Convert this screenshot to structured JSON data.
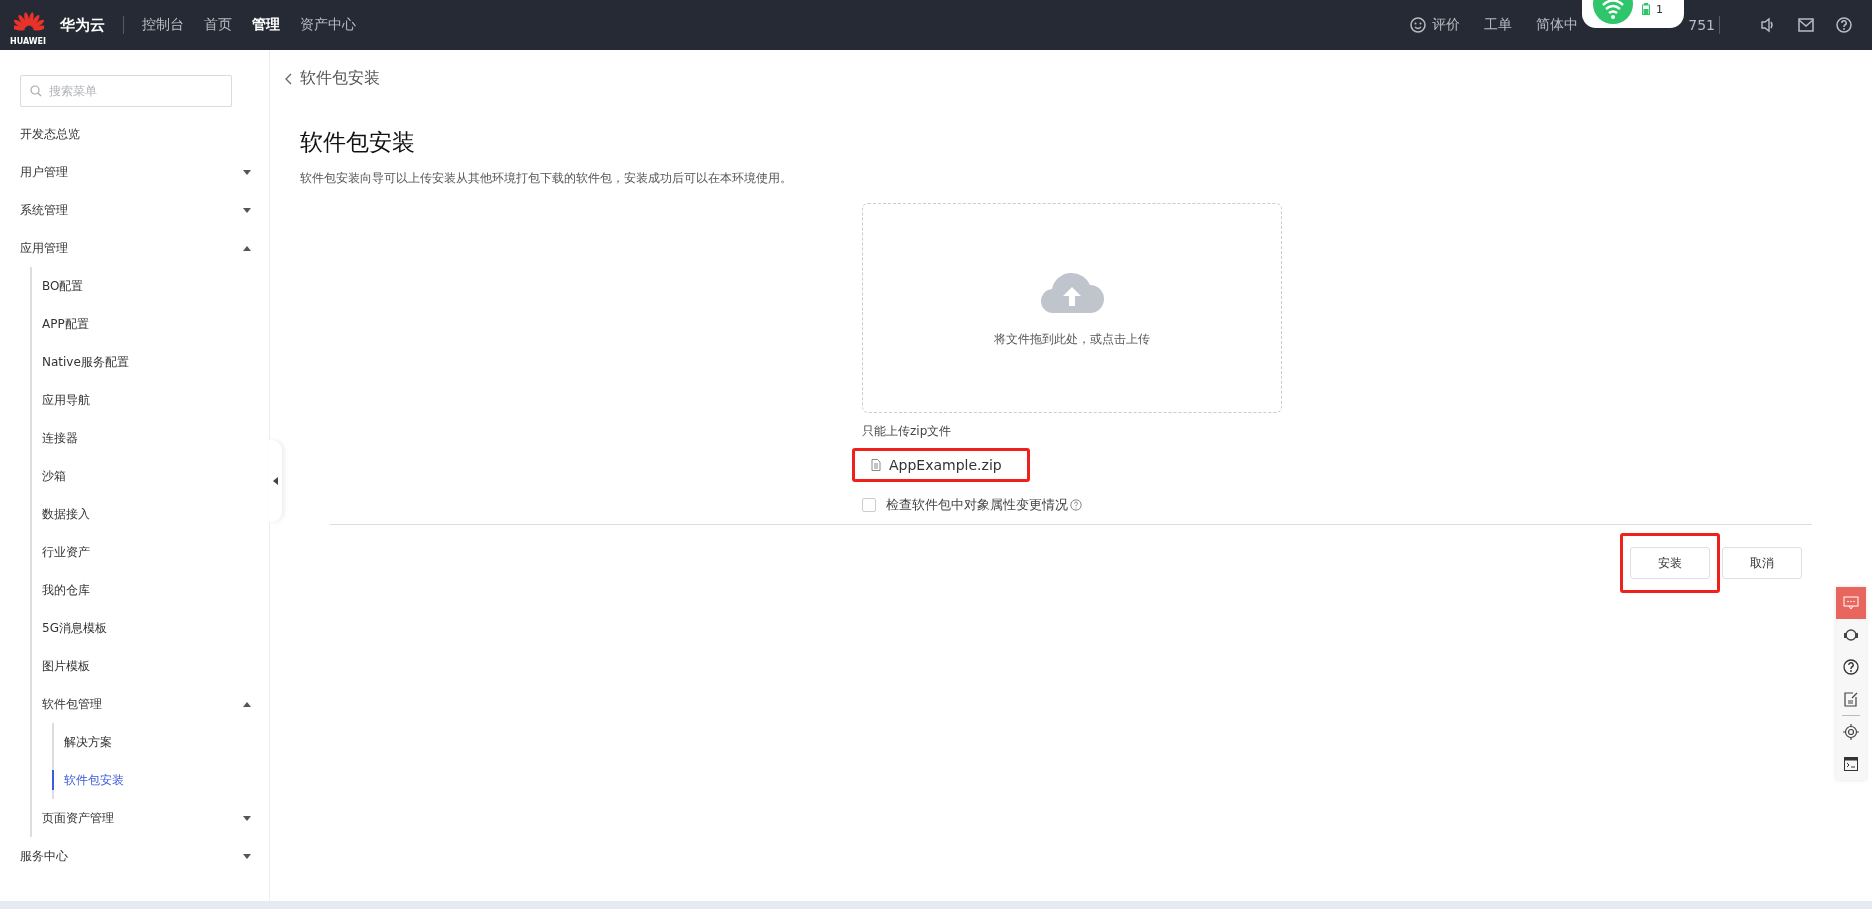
{
  "topbar": {
    "brand": "华为云",
    "logo_text": "HUAWEI",
    "nav": [
      {
        "label": "控制台",
        "selected": false
      },
      {
        "label": "首页",
        "selected": false
      },
      {
        "label": "管理",
        "selected": true
      },
      {
        "label": "资产中心",
        "selected": false
      }
    ],
    "right": [
      {
        "kind": "feedback",
        "label": "评价"
      },
      {
        "kind": "text",
        "label": "工单"
      },
      {
        "kind": "text",
        "label": "简体中"
      },
      {
        "kind": "text",
        "label": "751"
      }
    ],
    "popup": {
      "count": "1"
    }
  },
  "sidebar": {
    "search": {
      "placeholder": "搜索菜单"
    },
    "items": [
      {
        "label": "开发态总览",
        "selected": false
      },
      {
        "label": "用户管理",
        "expanded": false,
        "selected": false
      },
      {
        "label": "系统管理",
        "expanded": false,
        "selected": false
      },
      {
        "label": "应用管理",
        "expanded": true,
        "selected": false,
        "children": [
          {
            "label": "BO配置",
            "selected": false
          },
          {
            "label": "APP配置",
            "selected": false
          },
          {
            "label": "Native服务配置",
            "selected": false
          },
          {
            "label": "应用导航",
            "selected": false
          },
          {
            "label": "连接器",
            "selected": false
          },
          {
            "label": "沙箱",
            "selected": false
          },
          {
            "label": "数据接入",
            "selected": false
          },
          {
            "label": "行业资产",
            "selected": false
          },
          {
            "label": "我的仓库",
            "selected": false
          },
          {
            "label": "5G消息模板",
            "selected": false
          },
          {
            "label": "图片模板",
            "selected": false
          },
          {
            "label": "软件包管理",
            "expanded": true,
            "selected": false,
            "children": [
              {
                "label": "解决方案",
                "selected": false
              },
              {
                "label": "软件包安装",
                "selected": true
              }
            ]
          },
          {
            "label": "页面资产管理",
            "expanded": false,
            "selected": false
          }
        ]
      },
      {
        "label": "服务中心",
        "expanded": false,
        "selected": false
      }
    ]
  },
  "breadcrumb": "软件包安装",
  "page": {
    "title": "软件包安装",
    "description": "软件包安装向导可以上传安装从其他环境打包下载的软件包，安装成功后可以在本环境使用。",
    "upload": {
      "prompt": "将文件拖到此处，或点击上传",
      "hint": "只能上传zip文件"
    },
    "files": [
      {
        "name": "AppExample.zip",
        "highlighted": true
      }
    ],
    "option": {
      "label": "检查软件包中对象属性变更情况",
      "checked": false
    },
    "buttons": [
      {
        "label": "安装",
        "highlighted": true
      },
      {
        "label": "取消",
        "highlighted": false
      }
    ]
  }
}
